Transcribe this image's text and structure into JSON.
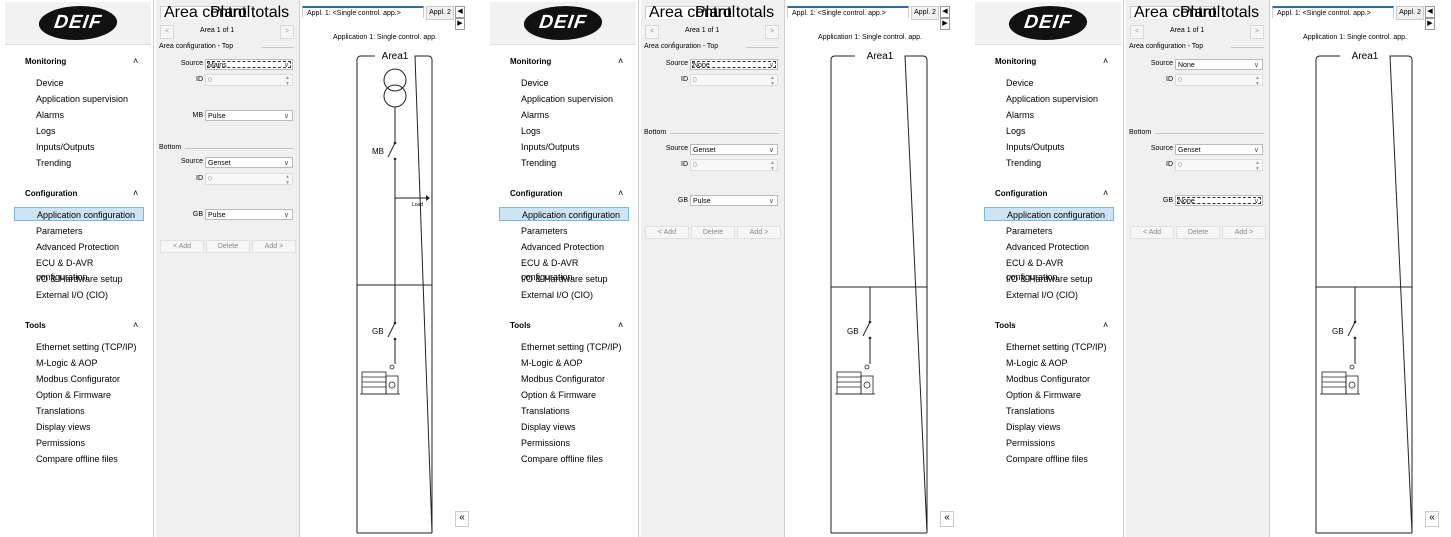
{
  "sidebar": {
    "logo": "DEIF",
    "sections": [
      {
        "label": "Monitoring",
        "items": [
          "Device",
          "Application supervision",
          "Alarms",
          "Logs",
          "Inputs/Outputs",
          "Trending"
        ]
      },
      {
        "label": "Configuration",
        "items": [
          "Application configuration",
          "Parameters",
          "Advanced Protection",
          "ECU & D-AVR configuration",
          "I/O & Hardware setup",
          "External I/O (CIO)"
        ]
      },
      {
        "label": "Tools",
        "items": [
          "Ethernet setting (TCP/IP)",
          "M-Logic & AOP",
          "Modbus Configurator",
          "Option & Firmware",
          "Translations",
          "Display views",
          "Permissions",
          "Compare offline files"
        ]
      }
    ],
    "selected_item": "Application configuration",
    "chevron": "˄"
  },
  "tabs": {
    "area_control": "Area control",
    "plant_totals": "Plant totals"
  },
  "nav": {
    "prev": "<",
    "next": ">",
    "area_counter": "Area 1 of 1"
  },
  "labels": {
    "top_group": "Area configuration - Top",
    "bottom_group": "Bottom",
    "source": "Source",
    "id": "ID",
    "mb": "MB",
    "gb": "GB",
    "id_value": "0",
    "add_left": "< Add",
    "delete": "Delete",
    "add_right": "Add >"
  },
  "right": {
    "tab_active": "Appl. 1: <Single control. app.>",
    "tab_inactive": "Appl. 2",
    "title": "Application 1: Single control. app.",
    "area_label": "Area1",
    "mb_label": "MB",
    "gb_label": "GB",
    "load_label": "Load",
    "collapse": "«",
    "arrow_left": "◀",
    "arrow_right": "▶"
  },
  "panels": [
    {
      "top_source": "Mains",
      "top_breaker": "MB",
      "top_breaker_value": "Pulse",
      "bottom_source": "Genset",
      "gb_value": "Pulse"
    },
    {
      "top_source": "None",
      "bottom_source": "Genset",
      "gb_value": "Pulse"
    },
    {
      "top_source": "None",
      "bottom_source": "Genset",
      "gb_value": "None"
    }
  ]
}
